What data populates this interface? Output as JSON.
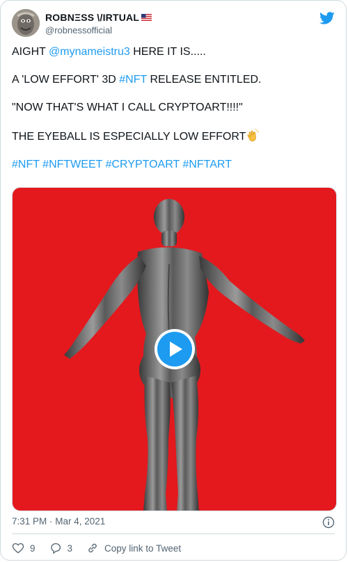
{
  "author": {
    "display_name": "ROBNΞSS \\/IRTUAL",
    "handle": "@robnessofficial"
  },
  "tweet": {
    "p1_prefix": "AIGHT ",
    "p1_mention": "@mynameistru3",
    "p1_suffix": " HERE IT IS.....",
    "p2_prefix": "A 'LOW EFFORT' 3D ",
    "p2_tag": "#NFT",
    "p2_suffix": " RELEASE ENTITLED.",
    "p3": "\"NOW THAT'S WHAT I CALL CRYPTOART!!!!\"",
    "p4": "THE EYEBALL IS ESPECIALLY LOW EFFORT",
    "hashtags": [
      "#NFT",
      "#NFTWEET",
      "#CRYPTOART",
      "#NFTART"
    ]
  },
  "media": {
    "background": "#e3191e",
    "play_color": "#1d9bf0"
  },
  "timestamp": "7:31 PM · Mar 4, 2021",
  "actions": {
    "likes": "9",
    "replies": "3",
    "copy_link": "Copy link to Tweet"
  },
  "colors": {
    "link": "#1d9bf0",
    "muted": "#536471"
  }
}
